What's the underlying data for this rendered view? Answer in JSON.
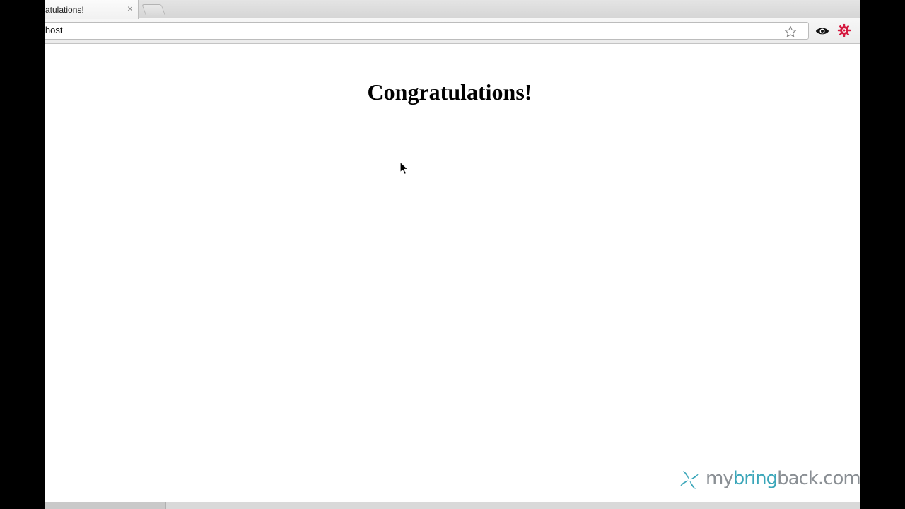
{
  "browser": {
    "tab": {
      "title": "atulations!",
      "close_glyph": "×"
    },
    "address_bar": {
      "url": "lhost"
    },
    "toolbar_icons": [
      "bookmark-star-icon",
      "eye-icon",
      "extension-gear-icon"
    ]
  },
  "page": {
    "heading": "Congratulations!"
  },
  "watermark": {
    "part1": "my",
    "part2": "bring",
    "part3": "back",
    "part4": ".com",
    "colors": {
      "gray": "#8a8f94",
      "teal": "#3aa6b9"
    }
  },
  "colors": {
    "frame": "#000000",
    "page_background": "#ffffff",
    "extension_icon": "#d4193f"
  }
}
